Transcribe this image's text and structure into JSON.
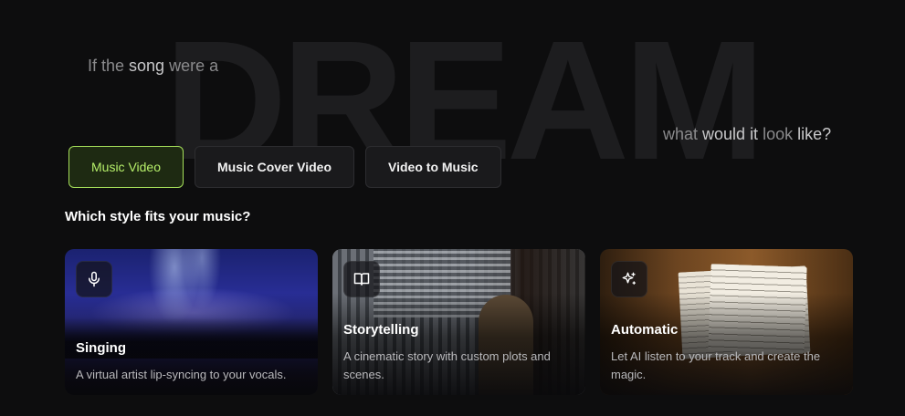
{
  "hero": {
    "big_word": "DREAM",
    "left_part1": "If the ",
    "left_part2": "song",
    "left_part3": " were a",
    "right_part1": "what ",
    "right_part2": "would it",
    "right_part3": " look ",
    "right_part4": "like?"
  },
  "tabs": [
    {
      "label": "Music Video",
      "active": true
    },
    {
      "label": "Music Cover Video",
      "active": false
    },
    {
      "label": "Video to Music",
      "active": false
    }
  ],
  "question": "Which style fits your music?",
  "cards": [
    {
      "title": "Singing",
      "icon": "microphone-icon",
      "description": "A virtual artist lip-syncing to your vocals."
    },
    {
      "title": "Storytelling",
      "icon": "book-icon",
      "description": "A cinematic story with custom plots and scenes."
    },
    {
      "title": "Automatic",
      "icon": "sparkle-icon",
      "description": "Let AI listen to your track and create the magic."
    }
  ],
  "colors": {
    "background": "#0d0d0e",
    "accent": "#a6e05a"
  }
}
